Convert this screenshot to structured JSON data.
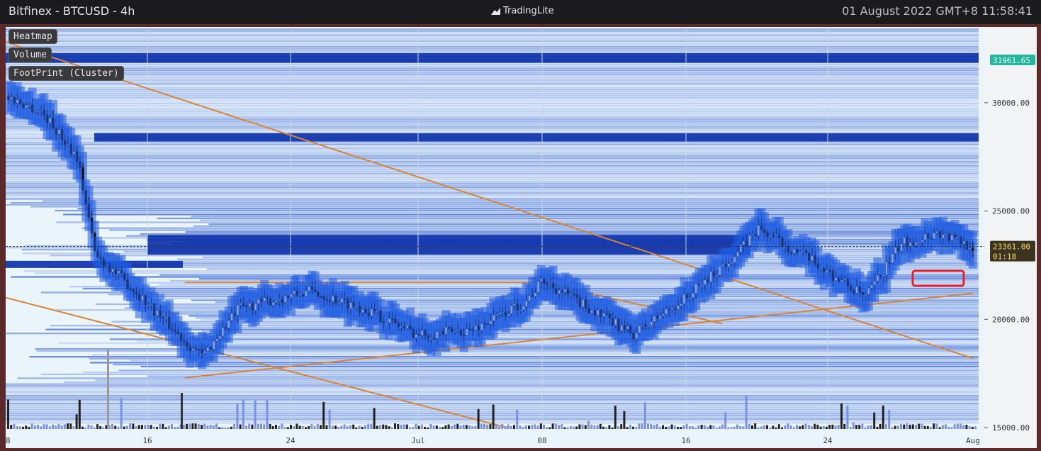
{
  "window": {
    "title": "Bitfinex - BTCUSD - 4h",
    "brand": "TradingLite",
    "timestamp": "01 August 2022 GMT+8 11:58:41"
  },
  "layers": [
    "Heatmap",
    "Volume",
    "FootPrint (Cluster)"
  ],
  "price_axis": {
    "ticks": [
      "30000.00",
      "25000.00",
      "20000.00",
      "15000.00"
    ],
    "last_price_label": "31961.65",
    "current_price_label": "23361.00",
    "countdown_label": "01:18"
  },
  "time_axis": {
    "ticks": [
      "8",
      "16",
      "24",
      "Jul",
      "08",
      "16",
      "24",
      "Aug"
    ]
  },
  "colors": {
    "heatmap_dark": "#0a2fa8",
    "heatmap_light": "#8fb3f0",
    "trendline": "#d8843a",
    "highlight_box": "#e8202a",
    "last_price_tag": "#22b8a0",
    "current_price_tag": "#3a3420"
  },
  "chart_data": {
    "type": "candlestick",
    "title": "Bitfinex - BTCUSD - 4h",
    "ylim": [
      15000,
      33500
    ],
    "x_ticks": [
      "8",
      "16",
      "24",
      "Jul",
      "08",
      "16",
      "24",
      "Aug"
    ],
    "y_ticks": [
      30000,
      25000,
      20000,
      15000
    ],
    "price_path": [
      {
        "x": "Jun 8",
        "close": 30300
      },
      {
        "x": "Jun 10",
        "close": 29600
      },
      {
        "x": "Jun 12",
        "close": 27500
      },
      {
        "x": "Jun 13",
        "close": 23000
      },
      {
        "x": "Jun 15",
        "close": 21500
      },
      {
        "x": "Jun 18",
        "close": 19000
      },
      {
        "x": "Jun 19",
        "close": 18300
      },
      {
        "x": "Jun 21",
        "close": 20500
      },
      {
        "x": "Jun 25",
        "close": 21300
      },
      {
        "x": "Jun 28",
        "close": 20500
      },
      {
        "x": "Jul 1",
        "close": 19300
      },
      {
        "x": "Jul 4",
        "close": 19500
      },
      {
        "x": "Jul 7",
        "close": 20800
      },
      {
        "x": "Jul 8",
        "close": 21800
      },
      {
        "x": "Jul 12",
        "close": 19800
      },
      {
        "x": "Jul 13",
        "close": 19300
      },
      {
        "x": "Jul 16",
        "close": 21000
      },
      {
        "x": "Jul 19",
        "close": 23200
      },
      {
        "x": "Jul 20",
        "close": 24200
      },
      {
        "x": "Jul 23",
        "close": 22700
      },
      {
        "x": "Jul 26",
        "close": 21000
      },
      {
        "x": "Jul 28",
        "close": 23500
      },
      {
        "x": "Jul 30",
        "close": 24000
      },
      {
        "x": "Aug 1",
        "close": 23361
      }
    ],
    "current_price": 23361.0,
    "marked_level": 31961.65
  }
}
